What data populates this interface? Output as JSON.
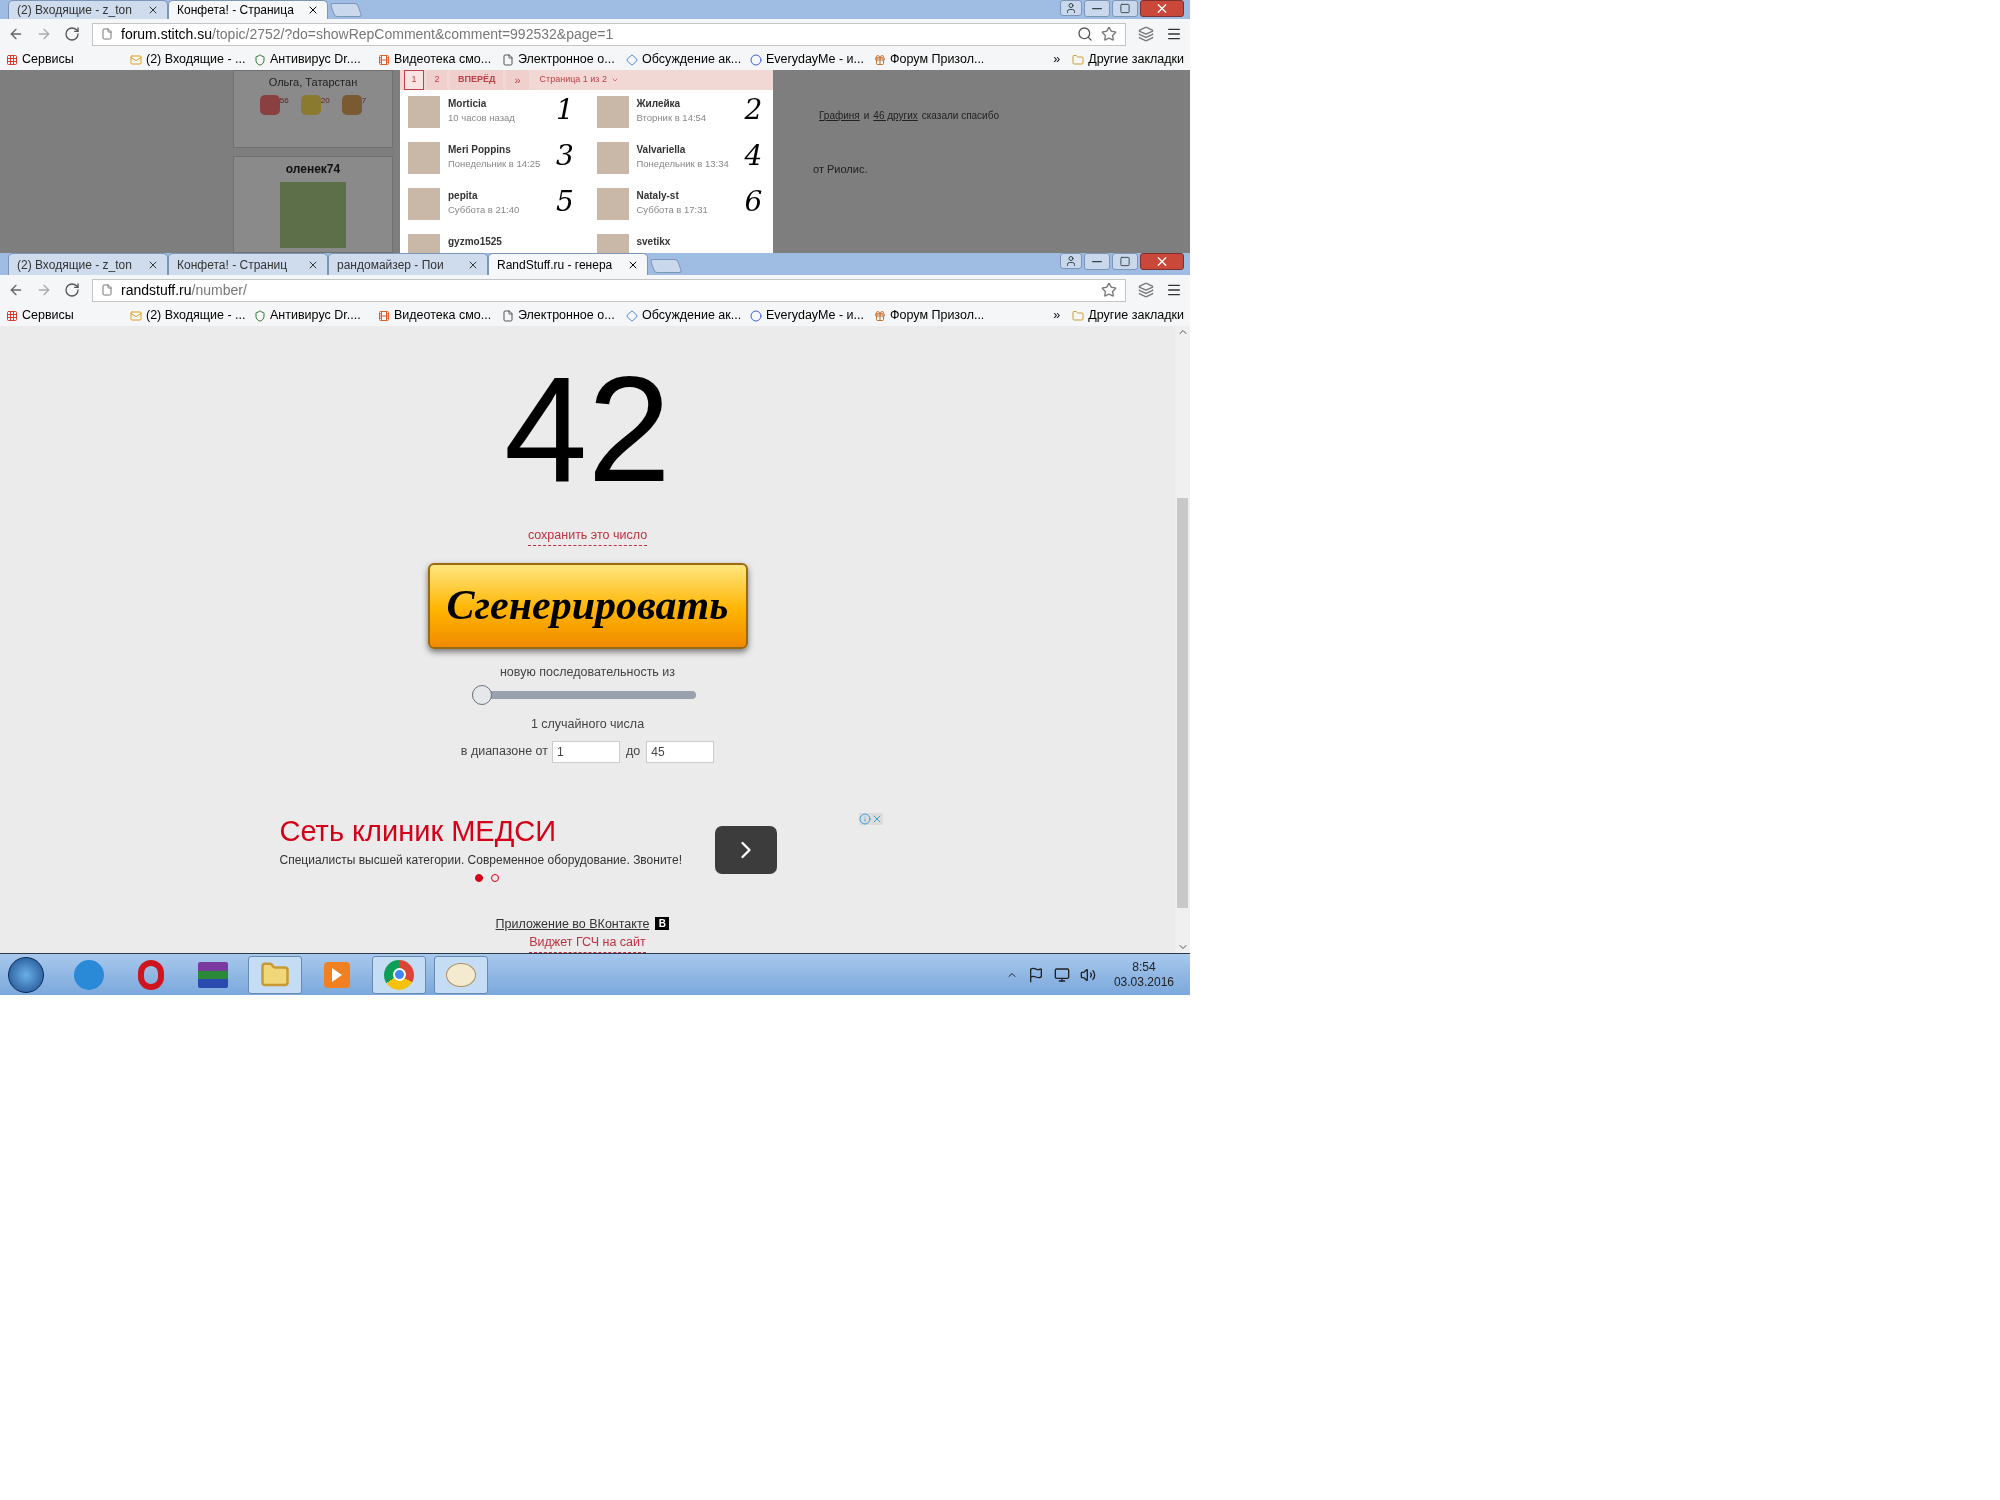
{
  "windows": [
    {
      "tabs": [
        {
          "title": "(2) Входящие - z_ton",
          "selected": false
        },
        {
          "title": "Конфета! - Страница",
          "selected": true
        }
      ],
      "url_host": "forum.stitch.su",
      "url_path": "/topic/2752/?do=showRepComment&comment=992532&page=1",
      "bookmarks": [
        "Сервисы",
        "(2) Входящие - ...",
        "Антивирус Dr....",
        "Видеотека смо...",
        "Электронное о...",
        "Обсуждение ак...",
        "EverydayMe - и...",
        "Форум Призол..."
      ],
      "more": "»",
      "other": "Другие закладки"
    },
    {
      "tabs": [
        {
          "title": "(2) Входящие - z_ton",
          "selected": false
        },
        {
          "title": "Конфета! - Страниц",
          "selected": false
        },
        {
          "title": "рандомайзер - Пои",
          "selected": false
        },
        {
          "title": "RandStuff.ru - генера",
          "selected": true
        }
      ],
      "url_host": "randstuff.ru",
      "url_path": "/number/",
      "bookmarks": [
        "Сервисы",
        "(2) Входящие - ...",
        "Антивирус Dr....",
        "Видеотека смо...",
        "Электронное о...",
        "Обсуждение ак...",
        "EverydayMe - и...",
        "Форум Призол..."
      ],
      "more": "»",
      "other": "Другие закладки"
    }
  ],
  "forum": {
    "location": "Ольга, Татарстан",
    "badges": [
      "56",
      "20",
      "7"
    ],
    "username": "оленек74",
    "thanks_name": "Графиня",
    "thanks_and": "и",
    "thanks_others": "46 других",
    "thanks_rest": "сказали спасибо",
    "post_tail": "от Риолис.",
    "popup": {
      "pages": [
        {
          "label": "1",
          "selected": true
        },
        {
          "label": "2",
          "selected": false
        }
      ],
      "next": "ВПЕРЁД",
      "last": "»",
      "page_menu": "Страница 1 из 2",
      "users": [
        {
          "name": "Morticia",
          "time": "10 часов назад",
          "mark": "1"
        },
        {
          "name": "Жилейка",
          "time": "Вторник в 14:54",
          "mark": "2"
        },
        {
          "name": "Meri Poppins",
          "time": "Понедельник в 14:25",
          "mark": "3"
        },
        {
          "name": "Valvariella",
          "time": "Понедельник в 13:34",
          "mark": "4"
        },
        {
          "name": "pepita",
          "time": "Суббота в 21:40",
          "mark": "5"
        },
        {
          "name": "Nataly-st",
          "time": "Суббота в 17:31",
          "mark": "6"
        },
        {
          "name": "gyzmo1525"
        },
        {
          "name": "svetikx"
        }
      ]
    }
  },
  "generator": {
    "number": "42",
    "save_link": "сохранить это число",
    "button": "Сгенерировать",
    "sequence_label": "новую последовательность из",
    "slider": {
      "level": 0
    },
    "count_label": "1 случайного числа",
    "range_label": "в диапазоне от",
    "from": "1",
    "to_label": "до",
    "to": "45"
  },
  "ad": {
    "title": "Сеть клиник МЕДСИ",
    "text": "Специалисты высшей категории. Современное оборудование. Звоните!",
    "dots": [
      {
        "selected": true
      },
      {
        "selected": false
      }
    ]
  },
  "footer": {
    "vk_link": "Приложение во ВКонтакте",
    "vk_logo": "B",
    "widget_link": "Виджет ГСЧ на сайт"
  },
  "taskbar": {
    "apps": [
      {
        "kind": "ie",
        "running": false
      },
      {
        "kind": "opera",
        "running": false
      },
      {
        "kind": "winrar",
        "running": false
      },
      {
        "kind": "explorer",
        "running": true
      },
      {
        "kind": "player",
        "running": false
      },
      {
        "kind": "chrome",
        "running": true
      },
      {
        "kind": "paint",
        "running": true
      }
    ],
    "time": "8:54",
    "date": "03.03.2016"
  }
}
